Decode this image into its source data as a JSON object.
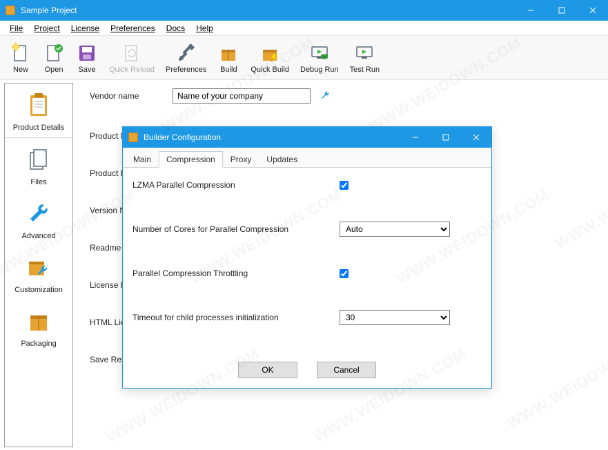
{
  "window": {
    "title": "Sample Project"
  },
  "menu": {
    "file": "File",
    "project": "Project",
    "license": "License",
    "preferences": "Preferences",
    "docs": "Docs",
    "help": "Help"
  },
  "toolbar": {
    "new": "New",
    "open": "Open",
    "save": "Save",
    "quick_reload": "Quick Reload",
    "preferences": "Preferences",
    "build": "Build",
    "quick_build": "Quick Build",
    "debug_run": "Debug Run",
    "test_run": "Test Run"
  },
  "sidebar": {
    "product_details": "Product Details",
    "files": "Files",
    "advanced": "Advanced",
    "customization": "Customization",
    "packaging": "Packaging"
  },
  "form": {
    "vendor_name_label": "Vendor name",
    "vendor_name_value": "Name of your company",
    "product_name_label": "Product Na",
    "product_file_label": "Product Fil",
    "version_number_label": "Version Nu",
    "readme_file_label": "Readme Fi",
    "license_file_label": "License File",
    "html_license_label": "HTML Lice",
    "save_relative_label": "Save Relative Paths"
  },
  "dialog": {
    "title": "Builder Configuration",
    "tabs": {
      "main": "Main",
      "compression": "Compression",
      "proxy": "Proxy",
      "updates": "Updates"
    },
    "lzma_label": "LZMA Parallel Compression",
    "lzma_checked": true,
    "cores_label": "Number of Cores for Parallel Compression",
    "cores_value": "Auto",
    "throttling_label": "Parallel Compression Throttling",
    "throttling_checked": true,
    "timeout_label": "Timeout for child processes initialization",
    "timeout_value": "30",
    "ok": "OK",
    "cancel": "Cancel"
  },
  "watermark": "WWW.WEIDOWN.COM"
}
